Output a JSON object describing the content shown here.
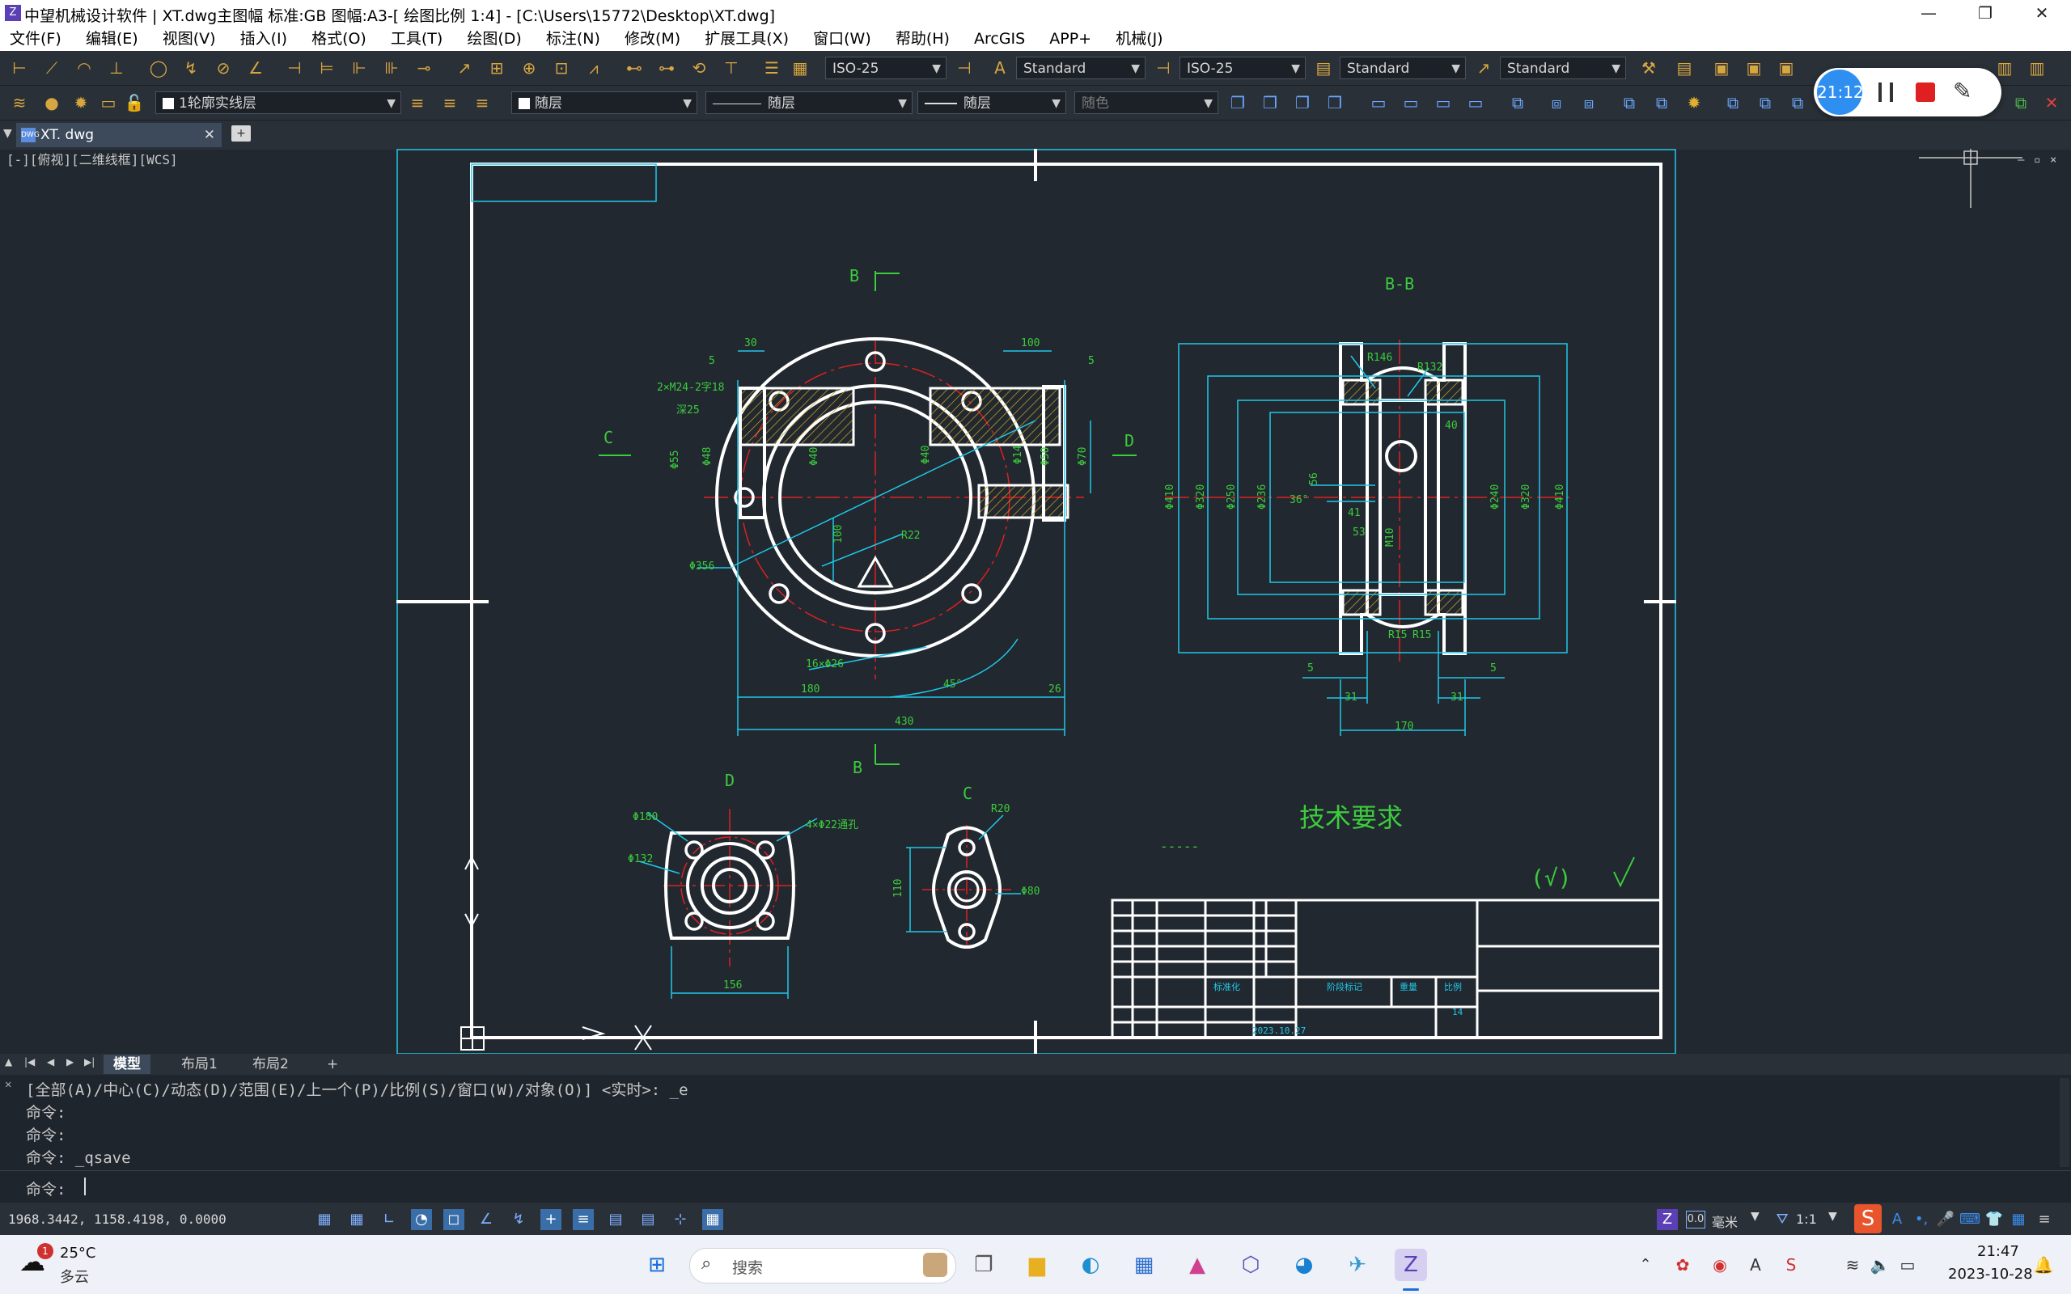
{
  "window": {
    "title": "中望机械设计软件 | XT.dwg主图幅  标准:GB 图幅:A3-[ 绘图比例 1:4] - [C:\\Users\\15772\\Desktop\\XT.dwg]",
    "app_icon": "zwcad-icon"
  },
  "menu": [
    "文件(F)",
    "编辑(E)",
    "视图(V)",
    "插入(I)",
    "格式(O)",
    "工具(T)",
    "绘图(D)",
    "标注(N)",
    "修改(M)",
    "扩展工具(X)",
    "窗口(W)",
    "帮助(H)",
    "ArcGIS",
    "APP+",
    "机械(J)"
  ],
  "toolbar1": {
    "dim_style": "ISO-25",
    "text_style": "Standard",
    "leader_style": "ISO-25",
    "table_style": "Standard",
    "mleader_style": "Standard"
  },
  "toolbar2": {
    "layer": "1轮廓实线层",
    "color": "随层",
    "linetype": "随层",
    "lineweight": "随层",
    "plotstyle": "随色"
  },
  "recorder": {
    "time": "21:12"
  },
  "file_tab": {
    "name": "XT. dwg"
  },
  "viewport_label": "[-][俯视][二维线框][WCS]",
  "drawing": {
    "labels": {
      "section_b": "B",
      "section_bb": "B-B",
      "view_c": "C",
      "view_d": "D",
      "tech_req": "技术要求",
      "tech_dash": "-----"
    },
    "dims": {
      "d30": "30",
      "d5a": "5",
      "d100": "100",
      "d5b": "5",
      "thread": "2×M24-2字18",
      "depth": "深25",
      "phi55": "Φ55",
      "phi48": "Φ48",
      "phi40": "Φ40",
      "phi14": "Φ14",
      "phi50": "Φ50",
      "phi70": "Φ70",
      "d100v": "100",
      "r22": "R22",
      "phi356": "Φ356",
      "holes": "16×Φ26",
      "d180": "180",
      "d45": "45°",
      "d26": "26",
      "d430": "430",
      "r146": "R146",
      "r132": "R132",
      "d40": "40",
      "phi410": "Φ410",
      "phi320": "Φ320",
      "phi250": "Φ250",
      "phi236": "Φ236",
      "d36": "36°",
      "d56": "56",
      "d41": "41",
      "d53": "53",
      "m10": "M10",
      "phi240": "Φ240",
      "phi320b": "Φ320",
      "phi410b": "Φ410",
      "r15a": "R15",
      "r15b": "R15",
      "d5c": "5",
      "d5d": "5",
      "d31a": "31",
      "d31b": "31",
      "d170": "170",
      "phi180": "Φ180",
      "phi132": "Φ132",
      "holes4": "4×Φ22通孔",
      "d156": "156",
      "r20": "R20",
      "d110": "110",
      "phi80": "Φ80"
    },
    "roughness": "(√)",
    "titleblock": {
      "scale_value": "14",
      "date": "2023.10.27",
      "r1": "标准化",
      "r2": "阶段标记",
      "r3": "重量",
      "r4": "比例"
    }
  },
  "layout_tabs": [
    "模型",
    "布局1",
    "布局2",
    "+"
  ],
  "command": {
    "history": [
      "[全部(A)/中心(C)/动态(D)/范围(E)/上一个(P)/比例(S)/窗口(W)/对象(O)] <实时>: _e",
      "命令:",
      "命令:",
      "命令: _qsave"
    ],
    "prompt": "命令: "
  },
  "status": {
    "coords": "1968.3442,  1158.4198,  0.0000",
    "units": "毫米",
    "scale": "1:1",
    "annot": "0.0"
  },
  "taskbar": {
    "weather_temp": "25°C",
    "weather_desc": "多云",
    "weather_badge": "1",
    "search_placeholder": "搜索",
    "time": "21:47",
    "date": "2023-10-28"
  },
  "colors": {
    "background": "#212830",
    "drawing_white": "#ffffff",
    "dim_cyan": "#20c8e8",
    "text_green": "#3ccc3c",
    "centerline_red": "#e02020",
    "hatch_yellow": "#c8a020"
  }
}
